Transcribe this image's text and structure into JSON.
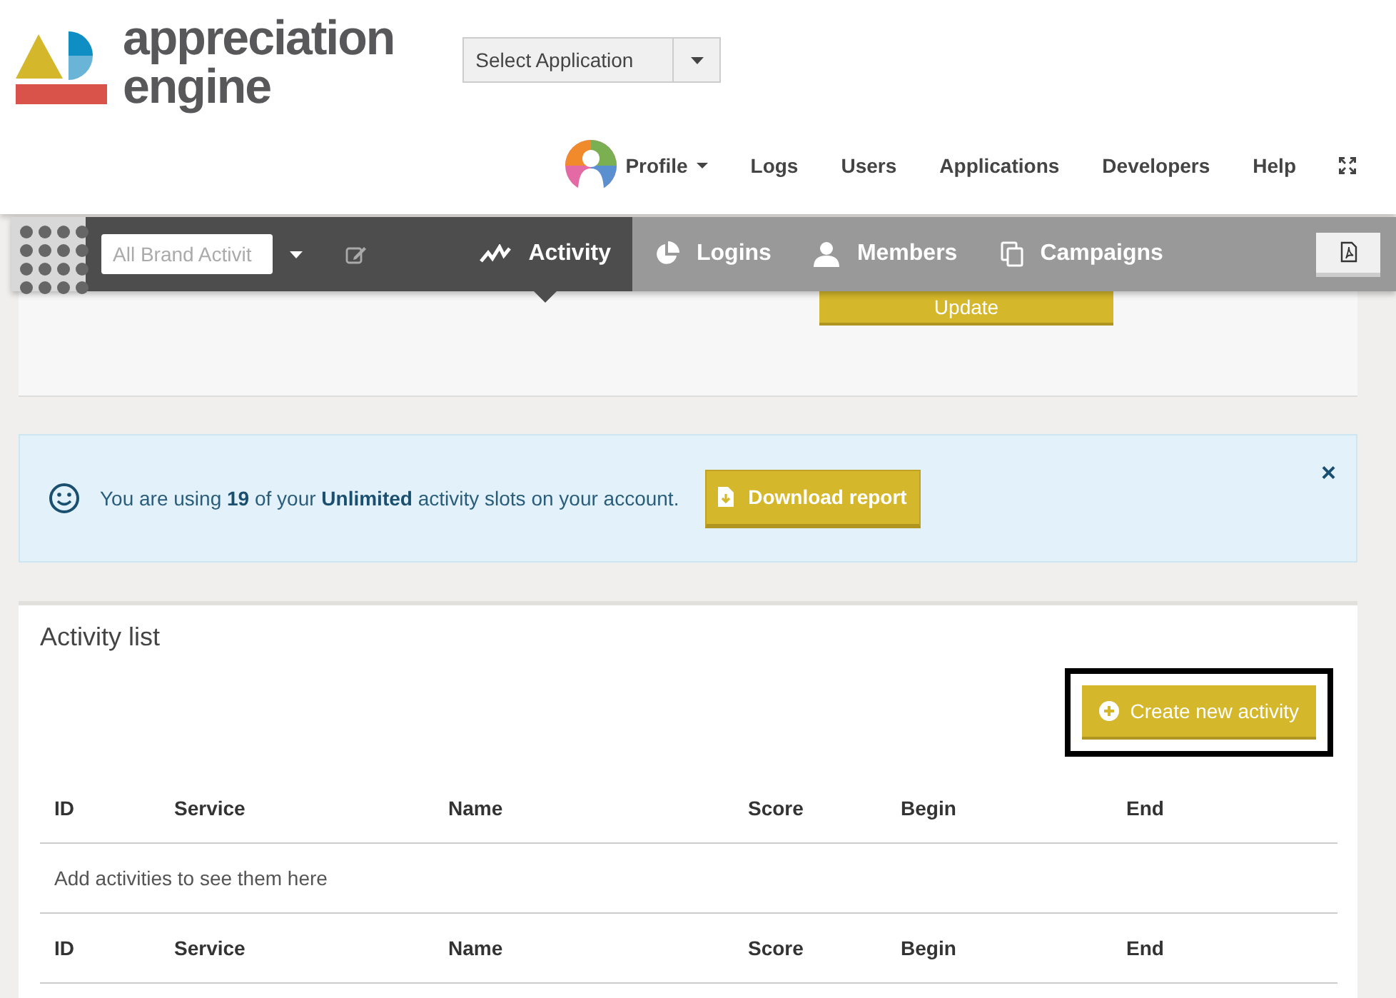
{
  "logo": {
    "lines": [
      "appreciation",
      "engine"
    ]
  },
  "app_select": {
    "value": "Select Application"
  },
  "top_nav": {
    "profile": "Profile",
    "items": [
      "Logs",
      "Users",
      "Applications",
      "Developers",
      "Help"
    ]
  },
  "toolbar": {
    "brand_filter": {
      "value": "All Brand Activit"
    },
    "tabs": [
      {
        "label": "Activity",
        "selected": true
      },
      {
        "label": "Logins",
        "selected": false
      },
      {
        "label": "Members",
        "selected": false
      },
      {
        "label": "Campaigns",
        "selected": false
      }
    ]
  },
  "filter_panel": {
    "update_button": "Update"
  },
  "alert": {
    "parts": [
      "You are using **19** of your **Unlimited** activity slots on your account."
    ],
    "button": "Download report",
    "close": "×"
  },
  "activity_list": {
    "title": "Activity list",
    "create_button": {
      "label": "Create new activity",
      "focused": true
    },
    "columns": [
      "ID",
      "Service",
      "Name",
      "Score",
      "Begin",
      "End"
    ],
    "empty_message": "Add activities to see them here",
    "footer_columns": [
      "ID",
      "Service",
      "Name",
      "Score",
      "Begin",
      "End"
    ]
  }
}
